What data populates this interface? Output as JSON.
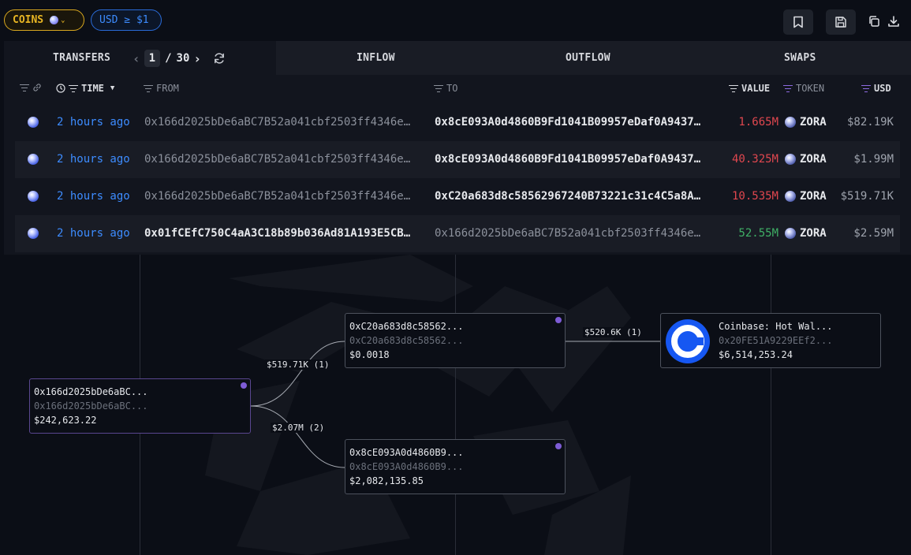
{
  "filters": {
    "coins_label": "COINS",
    "usd_label": "USD ≥ $1"
  },
  "tabs": {
    "transfers": "TRANSFERS",
    "page_current": "1",
    "page_sep": "/",
    "page_total": "30",
    "inflow": "INFLOW",
    "outflow": "OUTFLOW",
    "swaps": "SWAPS"
  },
  "columns": {
    "time": "TIME",
    "from": "FROM",
    "to": "TO",
    "value": "VALUE",
    "token": "TOKEN",
    "usd": "USD"
  },
  "rows": [
    {
      "time": "2 hours ago",
      "from": "0x166d2025bDe6aBC7B52a041cbf2503ff4346e…",
      "to": "0x8cE093A0d4860B9Fd1041B09957eDaf0A9437…",
      "value": "1.665M",
      "token": "ZORA",
      "usd": "$82.19K"
    },
    {
      "time": "2 hours ago",
      "from": "0x166d2025bDe6aBC7B52a041cbf2503ff4346e…",
      "to": "0x8cE093A0d4860B9Fd1041B09957eDaf0A9437…",
      "value": "40.325M",
      "token": "ZORA",
      "usd": "$1.99M"
    },
    {
      "time": "2 hours ago",
      "from": "0x166d2025bDe6aBC7B52a041cbf2503ff4346e…",
      "to": "0xC20a683d8c58562967240B73221c31c4C5a8A…",
      "value": "10.535M",
      "token": "ZORA",
      "usd": "$519.71K"
    },
    {
      "time": "2 hours ago",
      "from": "0x01fCEfC750C4aA3C18b89b036Ad81A193E5CB…",
      "to": "0x166d2025bDe6aBC7B52a041cbf2503ff4346e…",
      "value": "52.55M",
      "token": "ZORA",
      "usd": "$2.59M"
    }
  ],
  "colors": {
    "accent": "#3d8cff",
    "coins_gold": "#e7b523",
    "negative": "#e0474f",
    "positive": "#3fb066",
    "node_dot": "#7e5cd6"
  },
  "graph": {
    "nodes": {
      "source": {
        "l1": "0x166d2025bDe6aBC...",
        "l2": "0x166d2025bDe6aBC...",
        "l3": "$242,623.22"
      },
      "mid_top": {
        "l1": "0xC20a683d8c58562...",
        "l2": "0xC20a683d8c58562...",
        "l3": "$0.0018"
      },
      "mid_bottom": {
        "l1": "0x8cE093A0d4860B9...",
        "l2": "0x8cE093A0d4860B9...",
        "l3": "$2,082,135.85"
      },
      "coinbase": {
        "l1": "Coinbase: Hot Wal...",
        "l2": "0x20FE51A9229EEf2...",
        "l3": "$6,514,253.24"
      }
    },
    "edges": {
      "to_top": "$519.71K (1)",
      "to_bottom": "$2.07M (2)",
      "top_to_coinbase": "$520.6K (1)"
    }
  }
}
